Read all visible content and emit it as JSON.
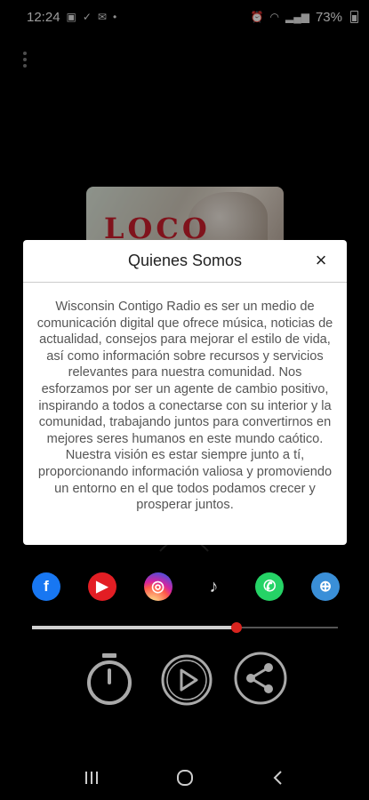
{
  "status_bar": {
    "time": "12:24",
    "battery": "73%",
    "left_icons": [
      "image-icon",
      "download-check-icon",
      "mail-icon",
      "dot-icon"
    ],
    "right_icons": [
      "alarm-icon",
      "wifi-icon",
      "signal-icon",
      "battery-icon"
    ]
  },
  "album": {
    "title": "LOCO"
  },
  "dialog": {
    "title": "Quienes Somos",
    "close_label": "×",
    "body": "Wisconsin Contigo Radio es ser un medio de comunicación digital que ofrece música, noticias de actualidad, consejos para mejorar el estilo de vida, así como información sobre recursos y servicios relevantes para nuestra comunidad. Nos esforzamos por ser un agente de cambio positivo, inspirando a todos a conectarse con su interior y  la comunidad, trabajando juntos para convertirnos en mejores seres humanos en este mundo caótico. Nuestra visión es estar siempre junto a tí, proporcionando información valiosa y promoviendo un entorno en el que todos podamos crecer y prosperar juntos."
  },
  "social": [
    {
      "icon": "facebook-icon",
      "glyph": "f",
      "color": "#1877f2"
    },
    {
      "icon": "youtube-icon",
      "glyph": "▶",
      "color": "#e31e24"
    },
    {
      "icon": "instagram-icon",
      "glyph": "◎",
      "color": "#d6249f"
    },
    {
      "icon": "tiktok-icon",
      "glyph": "♪",
      "color": "#000000"
    },
    {
      "icon": "whatsapp-icon",
      "glyph": "✆",
      "color": "#25d366"
    },
    {
      "icon": "globe-icon",
      "glyph": "⊕",
      "color": "#3a8fd8"
    }
  ],
  "player": {
    "progress_fraction": 0.67,
    "controls": [
      "timer-icon",
      "play-icon",
      "share-icon"
    ]
  },
  "colors": {
    "accent": "#d9241f",
    "background": "#000000",
    "dialog_bg": "#ffffff"
  }
}
